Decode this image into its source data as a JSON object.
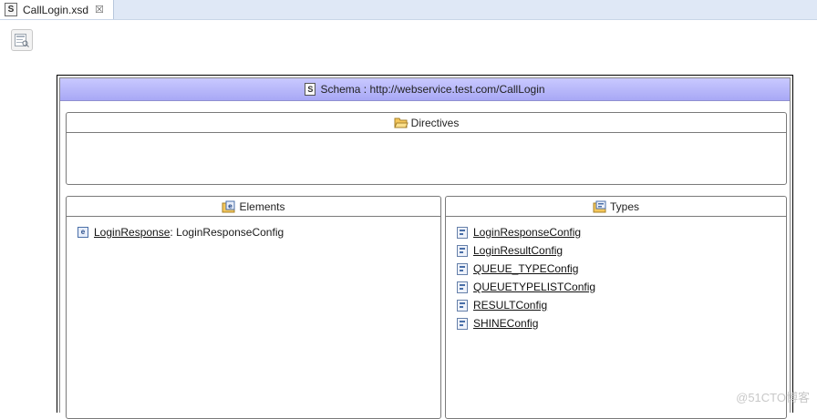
{
  "tab": {
    "title": "CallLogin.xsd",
    "close": "☒"
  },
  "schema": {
    "title": "Schema : http://webservice.test.com/CallLogin"
  },
  "directives": {
    "title": "Directives"
  },
  "elements": {
    "title": "Elements",
    "items": [
      {
        "name": "LoginResponse",
        "type": " : LoginResponseConfig"
      }
    ]
  },
  "types": {
    "title": "Types",
    "items": [
      {
        "name": "LoginResponseConfig"
      },
      {
        "name": "LoginResultConfig"
      },
      {
        "name": "QUEUE_TYPEConfig"
      },
      {
        "name": "QUEUETYPELISTConfig"
      },
      {
        "name": "RESULTConfig"
      },
      {
        "name": "SHINEConfig"
      }
    ]
  },
  "watermark": "@51CTO博客"
}
